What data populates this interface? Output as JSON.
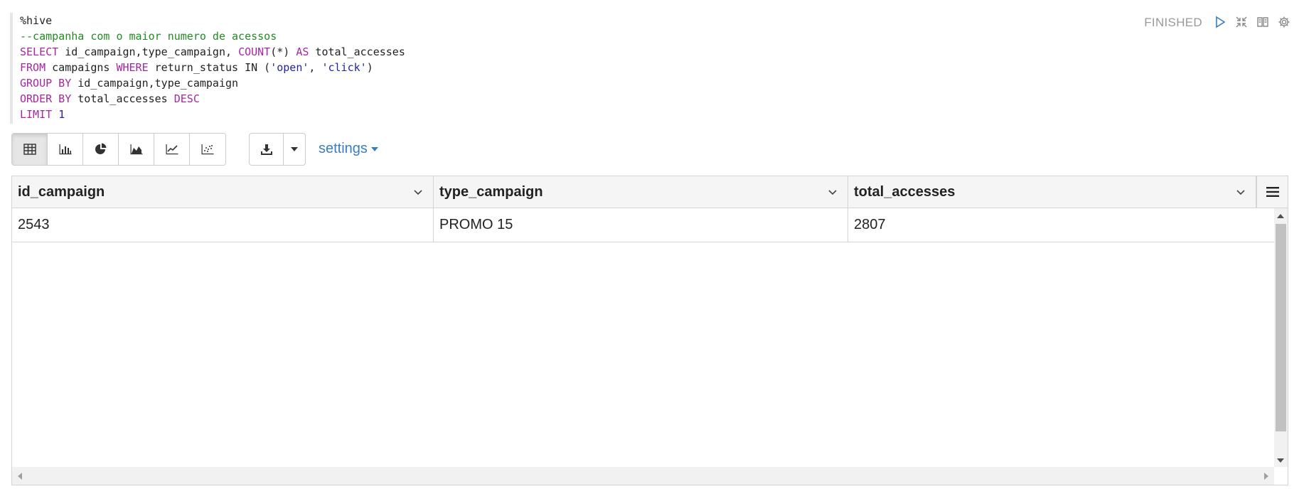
{
  "editor": {
    "lines": [
      [
        {
          "t": "%hive",
          "c": "plain"
        }
      ],
      [
        {
          "t": "--campanha com o maior numero de acessos",
          "c": "cmt"
        }
      ],
      [
        {
          "t": "SELECT",
          "c": "kw"
        },
        {
          "t": " id_campaign,type_campaign, ",
          "c": "plain"
        },
        {
          "t": "COUNT",
          "c": "kw"
        },
        {
          "t": "(*) ",
          "c": "plain"
        },
        {
          "t": "AS",
          "c": "kw"
        },
        {
          "t": " total_accesses",
          "c": "plain"
        }
      ],
      [
        {
          "t": "FROM",
          "c": "kw"
        },
        {
          "t": " campaigns ",
          "c": "plain"
        },
        {
          "t": "WHERE",
          "c": "kw"
        },
        {
          "t": " return_status IN (",
          "c": "plain"
        },
        {
          "t": "'open'",
          "c": "str"
        },
        {
          "t": ", ",
          "c": "plain"
        },
        {
          "t": "'click'",
          "c": "str"
        },
        {
          "t": ")",
          "c": "plain"
        }
      ],
      [
        {
          "t": "GROUP BY",
          "c": "kw"
        },
        {
          "t": " id_campaign,type_campaign",
          "c": "plain"
        }
      ],
      [
        {
          "t": "ORDER BY",
          "c": "kw"
        },
        {
          "t": " total_accesses ",
          "c": "plain"
        },
        {
          "t": "DESC",
          "c": "kw"
        }
      ],
      [
        {
          "t": "LIMIT",
          "c": "kw"
        },
        {
          "t": " ",
          "c": "plain"
        },
        {
          "t": "1",
          "c": "num"
        }
      ]
    ]
  },
  "status": {
    "label": "FINISHED"
  },
  "toolbar": {
    "viz_buttons": [
      "table-icon",
      "bar-chart-icon",
      "pie-chart-icon",
      "area-chart-icon",
      "line-chart-icon",
      "scatter-chart-icon"
    ],
    "active_index": 0,
    "settings_label": "settings"
  },
  "table": {
    "columns": [
      "id_campaign",
      "type_campaign",
      "total_accesses"
    ],
    "rows": [
      [
        "2543",
        "PROMO 15",
        "2807"
      ]
    ]
  },
  "colors": {
    "accent": "#3a7dc2",
    "status": "#999999"
  }
}
